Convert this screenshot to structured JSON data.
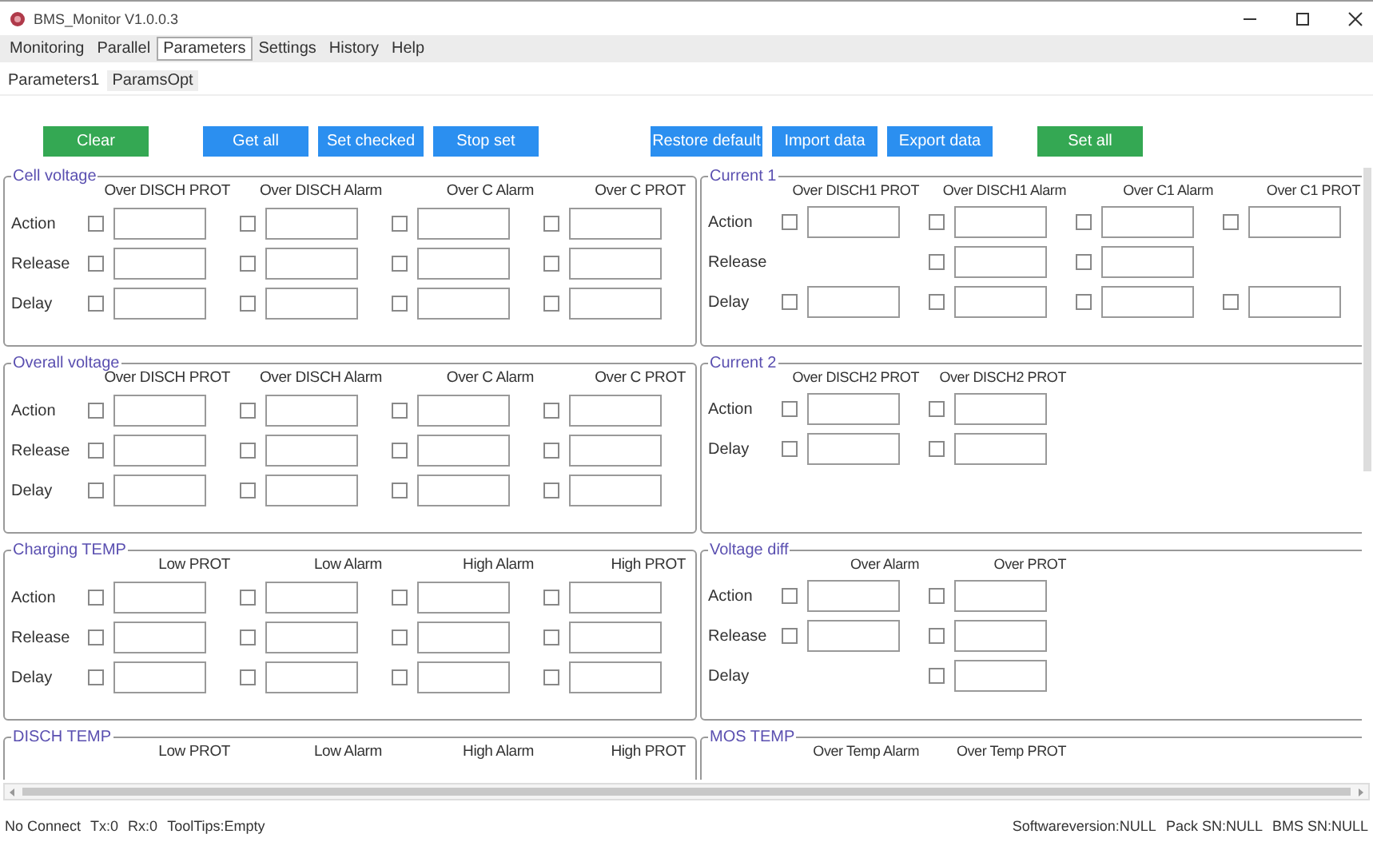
{
  "window": {
    "title": "BMS_Monitor V1.0.0.3"
  },
  "menu": [
    {
      "label": "Monitoring",
      "selected": false
    },
    {
      "label": "Parallel",
      "selected": false
    },
    {
      "label": "Parameters",
      "selected": true
    },
    {
      "label": "Settings",
      "selected": false
    },
    {
      "label": "History",
      "selected": false
    },
    {
      "label": "Help",
      "selected": false
    }
  ],
  "subtabs": [
    {
      "label": "Parameters1",
      "selected": true
    },
    {
      "label": "ParamsOpt",
      "selected": false
    }
  ],
  "buttons": [
    {
      "label": "Clear",
      "color": "#34a853"
    },
    {
      "label": "Get all",
      "color": "#2b8ff0"
    },
    {
      "label": "Set checked",
      "color": "#2b8ff0"
    },
    {
      "label": "Stop set",
      "color": "#2b8ff0"
    },
    {
      "label": "Restore default",
      "color": "#2b8ff0"
    },
    {
      "label": "Import data",
      "color": "#2b8ff0"
    },
    {
      "label": "Export data",
      "color": "#2b8ff0"
    },
    {
      "label": "Set all",
      "color": "#34a853"
    }
  ],
  "groups_left": [
    {
      "title": "Cell voltage",
      "columns": [
        "Over DISCH PROT",
        "Over DISCH Alarm",
        "Over C Alarm",
        "Over C PROT"
      ],
      "rows": [
        {
          "label": "Action",
          "cells": [
            {
              "kind": "field",
              "checked": false
            },
            {
              "kind": "field",
              "checked": false
            },
            {
              "kind": "field",
              "checked": false
            },
            {
              "kind": "field",
              "checked": false
            }
          ]
        },
        {
          "label": "Release",
          "cells": [
            {
              "kind": "field",
              "checked": false
            },
            {
              "kind": "field",
              "checked": false
            },
            {
              "kind": "field",
              "checked": false
            },
            {
              "kind": "field",
              "checked": false
            }
          ]
        },
        {
          "label": "Delay",
          "cells": [
            {
              "kind": "field",
              "checked": false
            },
            {
              "kind": "field",
              "checked": false
            },
            {
              "kind": "field",
              "checked": false
            },
            {
              "kind": "field",
              "checked": false
            }
          ]
        }
      ]
    },
    {
      "title": "Overall voltage",
      "columns": [
        "Over DISCH PROT",
        "Over DISCH Alarm",
        "Over C Alarm",
        "Over C PROT"
      ],
      "rows": [
        {
          "label": "Action",
          "cells": [
            {
              "kind": "field",
              "checked": false
            },
            {
              "kind": "field",
              "checked": false
            },
            {
              "kind": "field",
              "checked": false
            },
            {
              "kind": "field",
              "checked": false
            }
          ]
        },
        {
          "label": "Release",
          "cells": [
            {
              "kind": "field",
              "checked": false
            },
            {
              "kind": "field",
              "checked": false
            },
            {
              "kind": "field",
              "checked": false
            },
            {
              "kind": "field",
              "checked": false
            }
          ]
        },
        {
          "label": "Delay",
          "cells": [
            {
              "kind": "field",
              "checked": false
            },
            {
              "kind": "field",
              "checked": false
            },
            {
              "kind": "field",
              "checked": false
            },
            {
              "kind": "field",
              "checked": false
            }
          ]
        }
      ]
    },
    {
      "title": "Charging TEMP",
      "columns": [
        "Low PROT",
        "Low Alarm",
        "High Alarm",
        "High PROT"
      ],
      "rows": [
        {
          "label": "Action",
          "cells": [
            {
              "kind": "field",
              "checked": false
            },
            {
              "kind": "field",
              "checked": false
            },
            {
              "kind": "field",
              "checked": false
            },
            {
              "kind": "field",
              "checked": false
            }
          ]
        },
        {
          "label": "Release",
          "cells": [
            {
              "kind": "field",
              "checked": false
            },
            {
              "kind": "field",
              "checked": false
            },
            {
              "kind": "field",
              "checked": false
            },
            {
              "kind": "field",
              "checked": false
            }
          ]
        },
        {
          "label": "Delay",
          "cells": [
            {
              "kind": "field",
              "checked": false
            },
            {
              "kind": "field",
              "checked": false
            },
            {
              "kind": "field",
              "checked": false
            },
            {
              "kind": "field",
              "checked": false
            }
          ]
        }
      ]
    },
    {
      "title": "DISCH TEMP",
      "columns": [
        "Low PROT",
        "Low Alarm",
        "High Alarm",
        "High PROT"
      ]
    }
  ],
  "groups_right": [
    {
      "title": "Current 1",
      "columns": [
        "Over DISCH1 PROT",
        "Over DISCH1 Alarm",
        "Over C1 Alarm",
        "Over C1 PROT"
      ],
      "rows": [
        {
          "label": "Action",
          "cells": [
            {
              "kind": "field",
              "checked": false
            },
            {
              "kind": "field",
              "checked": false
            },
            {
              "kind": "field",
              "checked": false
            },
            {
              "kind": "field",
              "checked": false
            }
          ]
        },
        {
          "label": "Release",
          "cells": [
            {
              "kind": "empty"
            },
            {
              "kind": "field",
              "checked": false
            },
            {
              "kind": "field",
              "checked": false
            },
            {
              "kind": "empty"
            }
          ]
        },
        {
          "label": "Delay",
          "cells": [
            {
              "kind": "field",
              "checked": false
            },
            {
              "kind": "field",
              "checked": false
            },
            {
              "kind": "field",
              "checked": false
            },
            {
              "kind": "field",
              "checked": false
            }
          ]
        }
      ]
    },
    {
      "title": "Current 2",
      "columns": [
        "Over DISCH2 PROT",
        "Over DISCH2 PROT"
      ],
      "rows": [
        {
          "label": "Action",
          "cells": [
            {
              "kind": "field",
              "checked": false
            },
            {
              "kind": "field",
              "checked": false
            }
          ]
        },
        {
          "label": "Delay",
          "cells": [
            {
              "kind": "field",
              "checked": false
            },
            {
              "kind": "field",
              "checked": false
            }
          ]
        }
      ]
    },
    {
      "title": "Voltage diff",
      "columns": [
        "Over Alarm",
        "Over PROT"
      ],
      "rows": [
        {
          "label": "Action",
          "cells": [
            {
              "kind": "field",
              "checked": false
            },
            {
              "kind": "field",
              "checked": false
            }
          ]
        },
        {
          "label": "Release",
          "cells": [
            {
              "kind": "field",
              "checked": false
            },
            {
              "kind": "field",
              "checked": false
            }
          ]
        },
        {
          "label": "Delay",
          "cells": [
            {
              "kind": "empty"
            },
            {
              "kind": "field",
              "checked": false
            }
          ]
        }
      ]
    },
    {
      "title": "MOS TEMP",
      "columns": [
        "Over Temp Alarm",
        "Over Temp PROT"
      ]
    }
  ],
  "status_bar": {
    "left": [
      "No Connect",
      "Tx:0",
      "Rx:0",
      "ToolTips:Empty"
    ],
    "right": [
      "Softwareversion:NULL",
      "Pack SN:NULL",
      "BMS SN:NULL"
    ]
  }
}
